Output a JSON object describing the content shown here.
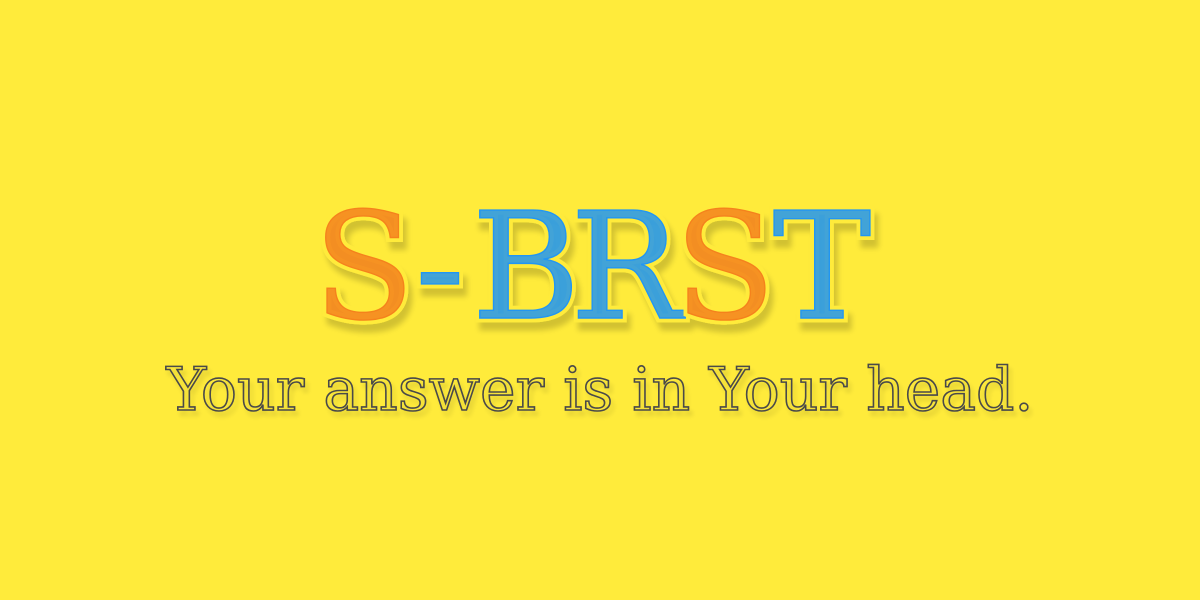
{
  "logo": {
    "letters": [
      {
        "char": "S",
        "style": "orange"
      },
      {
        "char": "-",
        "style": "blue"
      },
      {
        "char": "B",
        "style": "blue"
      },
      {
        "char": "R",
        "style": "blue"
      },
      {
        "char": "S",
        "style": "orange"
      },
      {
        "char": "T",
        "style": "blue"
      }
    ]
  },
  "tagline": {
    "text": "Your answer is in Your head."
  },
  "colors": {
    "background": "#FFEB3B",
    "orange": "#F5821F",
    "blue": "#2196F3",
    "tagline": "#4A4A4A"
  }
}
